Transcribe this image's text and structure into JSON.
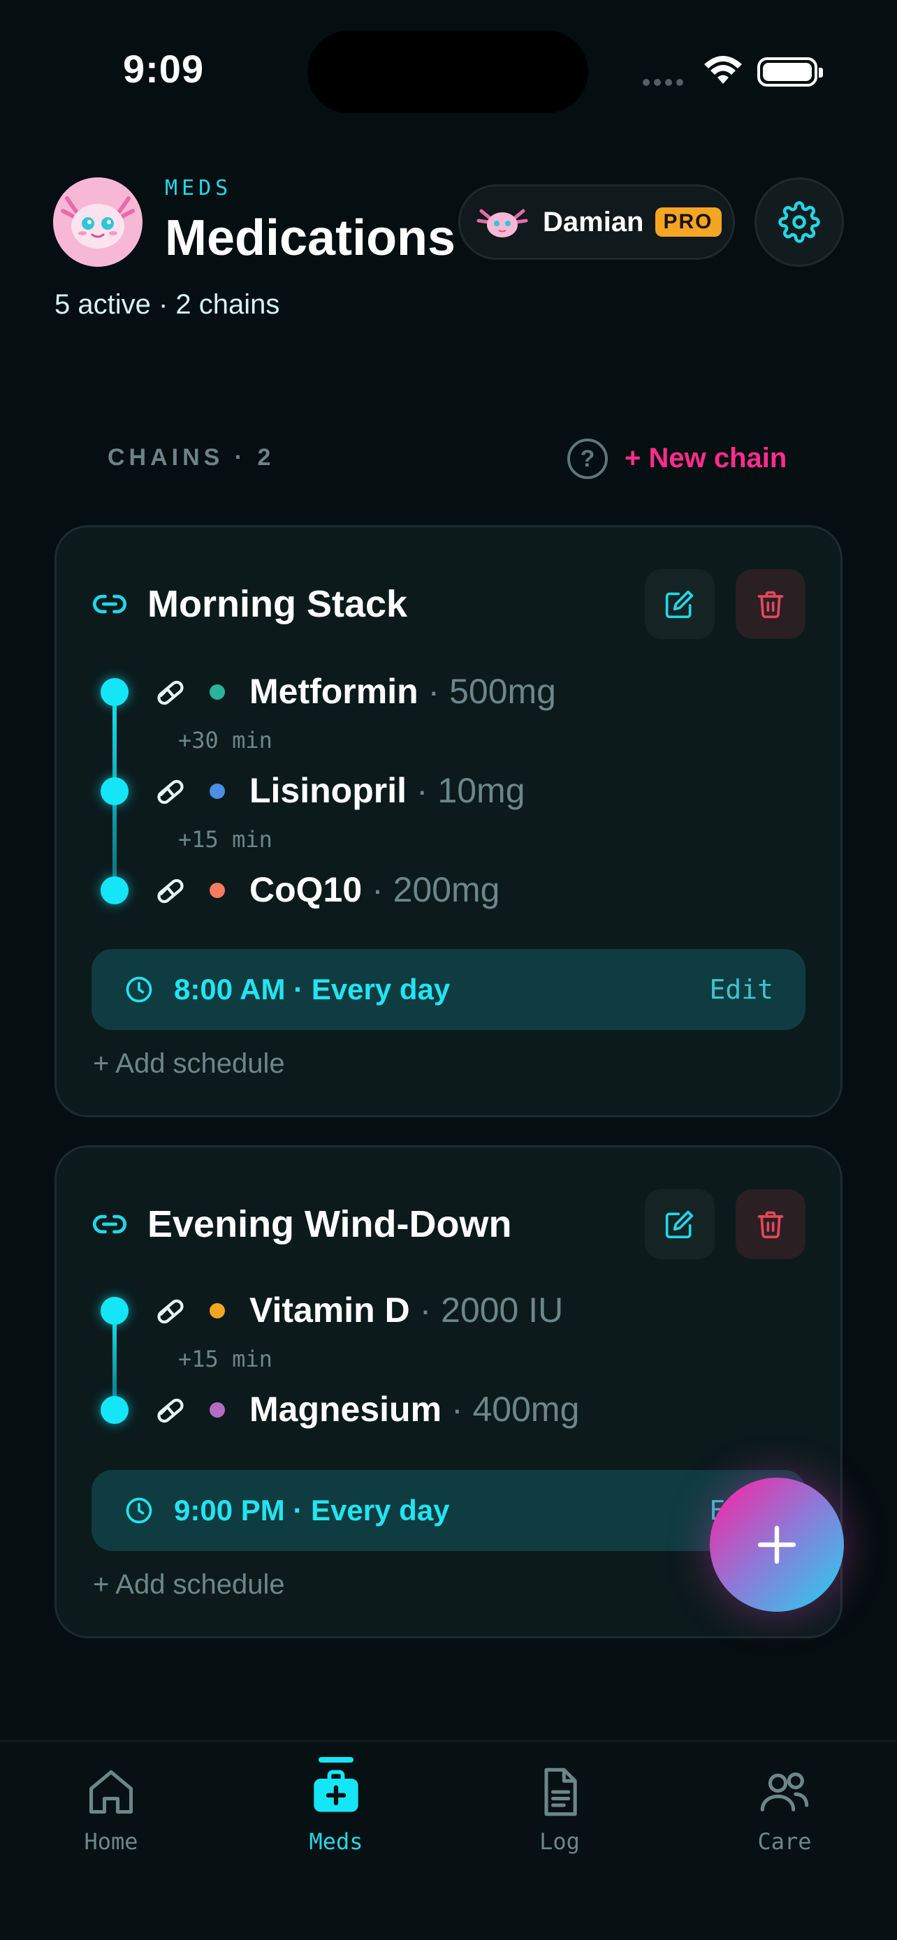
{
  "status_bar": {
    "time": "9:09"
  },
  "header": {
    "eyebrow": "MEDS",
    "title": "Medications",
    "subtitle": "5 active · 2 chains",
    "user": {
      "name": "Damian",
      "badge": "PRO"
    }
  },
  "chains_section": {
    "label": "CHAINS · 2",
    "help": "?",
    "new_chain": "+ New chain"
  },
  "chains": [
    {
      "title": "Morning Stack",
      "meds": [
        {
          "name": "Metformin",
          "dose": " · 500mg",
          "color": "#2bb39a"
        },
        {
          "name": "Lisinopril",
          "dose": " · 10mg",
          "color": "#4a90e2"
        },
        {
          "name": "CoQ10",
          "dose": " · 200mg",
          "color": "#f47c5f"
        }
      ],
      "gaps": [
        "+30 min",
        "+15 min"
      ],
      "schedule": "8:00 AM · Every day",
      "schedule_edit": "Edit",
      "add_schedule": "+ Add schedule"
    },
    {
      "title": "Evening Wind-Down",
      "meds": [
        {
          "name": "Vitamin D",
          "dose": " · 2000 IU",
          "color": "#f5a524"
        },
        {
          "name": "Magnesium",
          "dose": " · 400mg",
          "color": "#b76cc4"
        }
      ],
      "gaps": [
        "+15 min"
      ],
      "schedule": "9:00 PM · Every day",
      "schedule_edit": "Edit",
      "add_schedule": "+ Add schedule"
    }
  ],
  "tabs": [
    {
      "label": "Home",
      "icon": "home-icon"
    },
    {
      "label": "Meds",
      "icon": "medkit-icon",
      "active": true
    },
    {
      "label": "Log",
      "icon": "document-icon"
    },
    {
      "label": "Care",
      "icon": "people-icon"
    }
  ],
  "colors": {
    "accent": "#14e6f7",
    "new_chain": "#ff2d8c",
    "pro": "#f5a524"
  }
}
